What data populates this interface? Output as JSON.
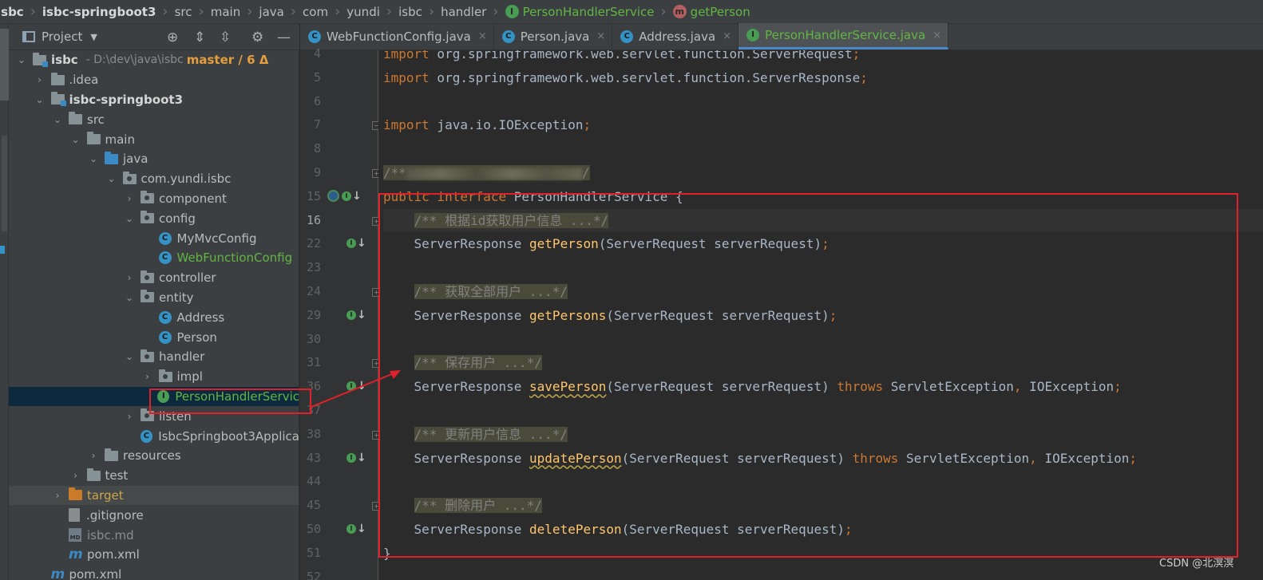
{
  "breadcrumb": [
    {
      "label": "isbc",
      "style": "bold"
    },
    {
      "label": "isbc-springboot3",
      "style": "bold"
    },
    {
      "label": "src"
    },
    {
      "label": "main"
    },
    {
      "label": "java"
    },
    {
      "label": "com"
    },
    {
      "label": "yundi"
    },
    {
      "label": "isbc"
    },
    {
      "label": "handler"
    },
    {
      "label": "PersonHandlerService",
      "style": "green",
      "icon": "interface-icon"
    },
    {
      "label": "getPerson",
      "style": "green",
      "icon": "method-icon"
    }
  ],
  "project_panel": {
    "title": "Project",
    "root": {
      "name": "isbc",
      "path": "- D:\\dev\\java\\isbc",
      "branch": "master / 6 Δ"
    },
    "tree": [
      {
        "label": ".idea",
        "depth": 1,
        "arrow": "›",
        "icon": "folder-icon"
      },
      {
        "label": "isbc-springboot3",
        "depth": 1,
        "arrow": "⌄",
        "icon": "module-folder-icon",
        "style": "b"
      },
      {
        "label": "src",
        "depth": 2,
        "arrow": "⌄",
        "icon": "folder-icon"
      },
      {
        "label": "main",
        "depth": 3,
        "arrow": "⌄",
        "icon": "folder-icon"
      },
      {
        "label": "java",
        "depth": 4,
        "arrow": "⌄",
        "icon": "source-folder-icon"
      },
      {
        "label": "com.yundi.isbc",
        "depth": 5,
        "arrow": "⌄",
        "icon": "package-icon"
      },
      {
        "label": "component",
        "depth": 6,
        "arrow": "›",
        "icon": "package-icon"
      },
      {
        "label": "config",
        "depth": 6,
        "arrow": "⌄",
        "icon": "package-icon"
      },
      {
        "label": "MyMvcConfig",
        "depth": 7,
        "icon": "class-icon"
      },
      {
        "label": "WebFunctionConfig",
        "depth": 7,
        "icon": "class-icon",
        "style": "green"
      },
      {
        "label": "controller",
        "depth": 6,
        "arrow": "›",
        "icon": "package-icon"
      },
      {
        "label": "entity",
        "depth": 6,
        "arrow": "⌄",
        "icon": "package-icon"
      },
      {
        "label": "Address",
        "depth": 7,
        "icon": "class-icon"
      },
      {
        "label": "Person",
        "depth": 7,
        "icon": "class-icon"
      },
      {
        "label": "handler",
        "depth": 6,
        "arrow": "⌄",
        "icon": "package-icon"
      },
      {
        "label": "impl",
        "depth": 7,
        "arrow": "›",
        "icon": "package-icon"
      },
      {
        "label": "PersonHandlerServic",
        "depth": 7,
        "icon": "interface-icon",
        "style": "green",
        "selected": true
      },
      {
        "label": "listen",
        "depth": 6,
        "arrow": "›",
        "icon": "package-icon"
      },
      {
        "label": "IsbcSpringboot3Applica",
        "depth": 6,
        "icon": "spring-class-icon"
      },
      {
        "label": "resources",
        "depth": 4,
        "arrow": "›",
        "icon": "resources-folder-icon"
      },
      {
        "label": "test",
        "depth": 3,
        "arrow": "›",
        "icon": "folder-icon"
      },
      {
        "label": "target",
        "depth": 2,
        "arrow": "›",
        "icon": "excluded-folder-icon",
        "style": "orange",
        "target": true
      },
      {
        "label": ".gitignore",
        "depth": 2,
        "icon": "file-icon"
      },
      {
        "label": "isbc.md",
        "depth": 2,
        "icon": "markdown-icon",
        "style": "dim"
      },
      {
        "label": "pom.xml",
        "depth": 2,
        "icon": "maven-icon"
      },
      {
        "label": "pom.xml",
        "depth": 1,
        "icon": "maven-icon"
      }
    ]
  },
  "editor_tabs": [
    {
      "label": "WebFunctionConfig.java",
      "icon": "class-icon",
      "close": "×"
    },
    {
      "label": "Person.java",
      "icon": "class-icon",
      "close": "×"
    },
    {
      "label": "Address.java",
      "icon": "class-icon",
      "close": "×"
    },
    {
      "label": "PersonHandlerService.java",
      "icon": "interface-icon",
      "close": "×",
      "active": true
    }
  ],
  "code": {
    "lines": [
      {
        "n": "4",
        "html": "<span class='kw'>import</span> org.springframework.web.servlet.function.ServerRequest<span class='kw'>;</span>"
      },
      {
        "n": "5",
        "html": "<span class='kw'>import</span> org.springframework.web.servlet.function.ServerResponse<span class='kw'>;</span>"
      },
      {
        "n": "6",
        "html": ""
      },
      {
        "n": "7",
        "html": "<span class='kw'>import</span> java.io.IOException<span class='kw'>;</span>",
        "fold": "-"
      },
      {
        "n": "8",
        "html": ""
      },
      {
        "n": "9",
        "html": "<span class='cmb'>/**<span class='blur' style='width:220px'></span>/</span>",
        "fold": "+"
      },
      {
        "n": "15",
        "html": "<span class='kw'>public interface</span> PersonHandlerService {",
        "gutter": "impl"
      },
      {
        "n": "16",
        "html": "    <span class='cm'>/** 根据id获取用户信息 ...*/</span>",
        "fold": "+",
        "current": true
      },
      {
        "n": "22",
        "html": "    ServerResponse <span class='fn'>getPerson</span>(ServerRequest serverRequest)<span class='kw'>;</span>",
        "gutter": "impl"
      },
      {
        "n": "23",
        "html": ""
      },
      {
        "n": "24",
        "html": "    <span class='cm'>/** 获取全部用户 ...*/</span>",
        "fold": "+"
      },
      {
        "n": "29",
        "html": "    ServerResponse <span class='fn'>getPersons</span>(ServerRequest serverRequest)<span class='kw'>;</span>",
        "gutter": "impl"
      },
      {
        "n": "30",
        "html": ""
      },
      {
        "n": "31",
        "html": "    <span class='cm'>/** 保存用户 ...*/</span>",
        "fold": "+"
      },
      {
        "n": "36",
        "html": "    ServerResponse <span class='fn ul'>savePerson</span>(ServerRequest serverRequest) <span class='kw'>throws</span> ServletException<span class='kw'>,</span> IOException<span class='kw'>;</span>",
        "gutter": "impl"
      },
      {
        "n": "37",
        "html": ""
      },
      {
        "n": "38",
        "html": "    <span class='cm'>/** 更新用户信息 ...*/</span>",
        "fold": "+"
      },
      {
        "n": "43",
        "html": "    ServerResponse <span class='fn ul'>updatePerson</span>(ServerRequest serverRequest) <span class='kw'>throws</span> ServletException<span class='kw'>,</span> IOException<span class='kw'>;</span>",
        "gutter": "impl"
      },
      {
        "n": "44",
        "html": ""
      },
      {
        "n": "45",
        "html": "    <span class='cm'>/** 删除用户 ...*/</span>",
        "fold": "+"
      },
      {
        "n": "50",
        "html": "    ServerResponse <span class='fn'>deletePerson</span>(ServerRequest serverRequest)<span class='kw'>;</span>",
        "gutter": "impl"
      },
      {
        "n": "51",
        "html": "}"
      },
      {
        "n": "52",
        "html": ""
      }
    ]
  },
  "watermark": "CSDN @北溟溟",
  "colors": {
    "highlight": "#e0202a",
    "keyword": "#cc7832",
    "method": "#ffc66d",
    "interface": "#62b543"
  }
}
